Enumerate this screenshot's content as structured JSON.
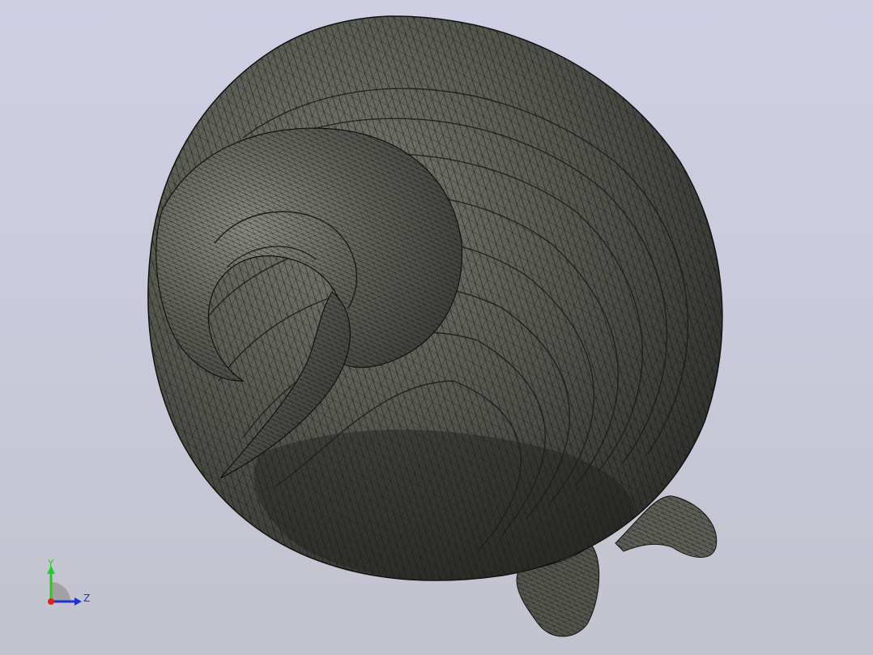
{
  "viewport": {
    "background_top": "#cfcfe4",
    "background_bottom": "#c2c3cd",
    "model": {
      "style": "shaded-with-edges",
      "surface_color": "#55574f",
      "edge_color": "#111111",
      "model_icon": "spiral-shell-mesh-icon"
    }
  },
  "triad": {
    "y_label": "Y",
    "z_label": "Z",
    "x_color": "#dd2222",
    "y_color": "#22cc22",
    "z_color": "#2233cc"
  }
}
